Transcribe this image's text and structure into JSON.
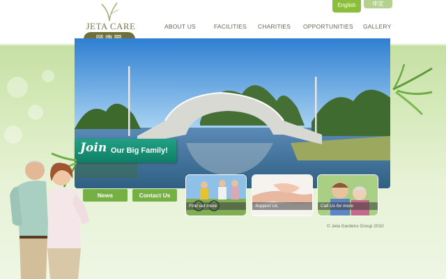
{
  "language": {
    "english": "English",
    "chinese": "中文"
  },
  "logo": {
    "name": "JETA CARE",
    "chinese": "頤康閣"
  },
  "nav": [
    {
      "label": "ABOUT US"
    },
    {
      "label": "FACILITIES"
    },
    {
      "label": "CHARITIES"
    },
    {
      "label": "OPPORTUNITIES"
    },
    {
      "label": "GALLERY"
    }
  ],
  "hero": {
    "banner_join": "Join",
    "banner_rest": "Our Big Family!"
  },
  "buttons": {
    "news": "News",
    "contact": "Contact Us"
  },
  "thumbnails": [
    {
      "caption": "Find out more"
    },
    {
      "caption": "Support Us"
    },
    {
      "caption": "Call Us for more"
    }
  ],
  "footer": {
    "copyright": "© Jeta Gardens Group 2010"
  },
  "colors": {
    "accent_green": "#74b142",
    "banner_teal": "#1a9278",
    "sky_blue": "#3b86d6",
    "page_green": "#d6eabb"
  }
}
